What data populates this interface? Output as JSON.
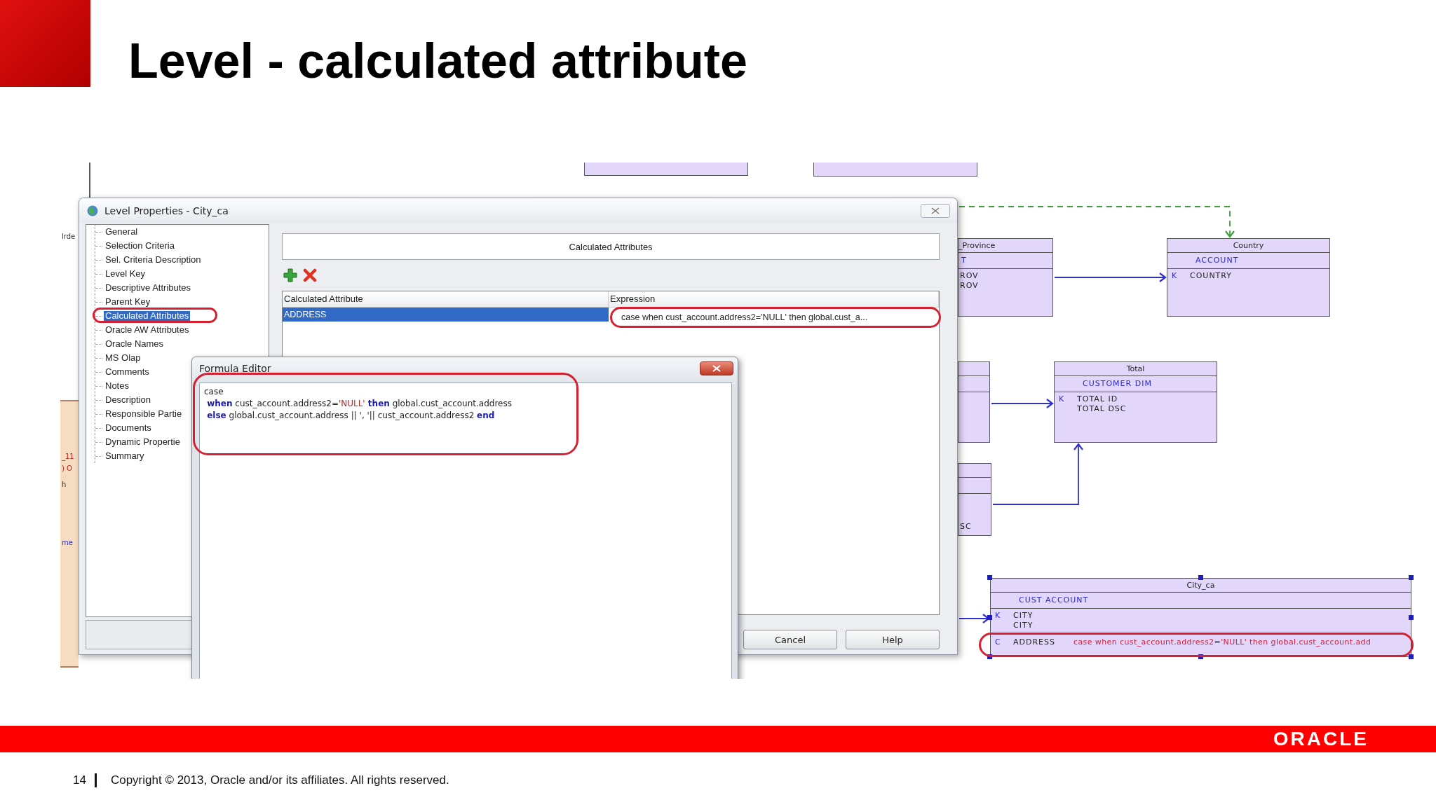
{
  "slide": {
    "title": "Level - calculated attribute",
    "logo": "ORACLE",
    "page_number": "14",
    "copyright": "Copyright © 2013, Oracle and/or its affiliates. All rights reserved."
  },
  "screenshot": {
    "left_fragments": [
      "lrde",
      "_11",
      ") O",
      "h",
      "me"
    ],
    "level_properties": {
      "title": "Level Properties - City_ca",
      "nav": [
        {
          "label": "General",
          "selected": false
        },
        {
          "label": "Selection Criteria",
          "selected": false
        },
        {
          "label": "Sel. Criteria Description",
          "selected": false
        },
        {
          "label": "Level Key",
          "selected": false
        },
        {
          "label": "Descriptive Attributes",
          "selected": false
        },
        {
          "label": "Parent Key",
          "selected": false
        },
        {
          "label": "Calculated Attributes",
          "selected": true
        },
        {
          "label": "Oracle AW Attributes",
          "selected": false
        },
        {
          "label": "Oracle Names",
          "selected": false
        },
        {
          "label": "MS Olap",
          "selected": false
        },
        {
          "label": "Comments",
          "selected": false
        },
        {
          "label": "Notes",
          "selected": false
        },
        {
          "label": "Description",
          "selected": false
        },
        {
          "label": "Responsible Partie",
          "selected": false
        },
        {
          "label": "Documents",
          "selected": false
        },
        {
          "label": "Dynamic Propertie",
          "selected": false
        },
        {
          "label": "Summary",
          "selected": false
        }
      ],
      "panel_title": "Calculated Attributes",
      "columns": [
        "Calculated Attribute",
        "Expression"
      ],
      "rows": [
        {
          "attribute": "ADDRESS",
          "expression": "case when cust_account.address2='NULL' then global.cust_a...",
          "selected": true
        }
      ],
      "buttons": [
        "Cancel",
        "Help"
      ]
    },
    "formula_editor": {
      "title": "Formula Editor",
      "lines": [
        [
          {
            "kind": "plain",
            "text": "case"
          }
        ],
        [
          {
            "kind": "keyword",
            "text": " when"
          },
          {
            "kind": "plain",
            "text": " cust_account.address2="
          },
          {
            "kind": "string",
            "text": "'NULL'"
          },
          {
            "kind": "keyword",
            "text": " then"
          },
          {
            "kind": "plain",
            "text": " global.cust_account.address"
          }
        ],
        [
          {
            "kind": "keyword",
            "text": " else"
          },
          {
            "kind": "plain",
            "text": " global.cust_account.address || ', '|| cust_account.address2 "
          },
          {
            "kind": "keyword",
            "text": "end"
          }
        ]
      ]
    },
    "diagram": {
      "entities": [
        {
          "title": "_Province",
          "subtitle": "T",
          "selected": false,
          "rows": [
            {
              "name": "ROV"
            },
            {
              "name": "ROV"
            }
          ]
        },
        {
          "title": "Country",
          "subtitle": "ACCOUNT",
          "selected": false,
          "rows": [
            {
              "key": "K",
              "name": "COUNTRY"
            }
          ]
        },
        {
          "title": "Total",
          "subtitle": "CUSTOMER DIM",
          "selected": false,
          "rows": [
            {
              "key": "K",
              "name": "TOTAL ID"
            },
            {
              "name": "TOTAL DSC"
            }
          ]
        },
        {
          "selected": false,
          "rows": [
            {
              "name": "SC"
            }
          ]
        },
        {
          "title": "City_ca",
          "subtitle": "CUST ACCOUNT",
          "selected": true,
          "rows": [
            {
              "key": "K",
              "name": "CITY"
            },
            {
              "name": "CITY"
            },
            {
              "key": "C",
              "name": "ADDRESS",
              "expression": "case when cust_account.address2='NULL' then global.cust_account.add"
            }
          ]
        }
      ]
    }
  }
}
